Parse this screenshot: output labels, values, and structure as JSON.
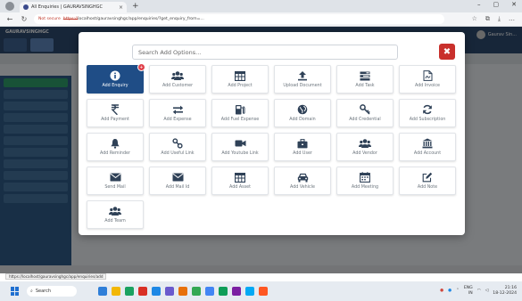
{
  "browser": {
    "tab_title": "All Enquiries | GAURAVSINGHGC",
    "close_tab": "×",
    "new_tab": "+",
    "url_security": "Not secure",
    "url_scheme": "https://",
    "url_rest": "localhost/gauravsinghgc/app/enquiries/?get_enquiry_from=...",
    "window_controls": [
      "–",
      "▢",
      "✕"
    ],
    "toolbar_icons": [
      "☆",
      "⧉",
      "⤓",
      "…"
    ]
  },
  "app": {
    "brand": "GAURAVSINGHGC",
    "user_name": "Gaurav Sin..."
  },
  "modal": {
    "search_placeholder": "Search Add Options...",
    "close_label": "✖",
    "items": [
      {
        "label": "Add Enquiry",
        "icon": "info-icon",
        "active": true,
        "badge": "+"
      },
      {
        "label": "Add Customer",
        "icon": "users-icon"
      },
      {
        "label": "Add Project",
        "icon": "table-icon"
      },
      {
        "label": "Upload Document",
        "icon": "upload-icon"
      },
      {
        "label": "Add Task",
        "icon": "tasks-icon"
      },
      {
        "label": "Add Invoice",
        "icon": "invoice-icon"
      },
      {
        "label": "Add Payment",
        "icon": "rupee-icon"
      },
      {
        "label": "Add Expense",
        "icon": "exchange-icon"
      },
      {
        "label": "Add Fuel Expense",
        "icon": "fuel-icon"
      },
      {
        "label": "Add Domain",
        "icon": "globe-icon"
      },
      {
        "label": "Add Credential",
        "icon": "key-icon"
      },
      {
        "label": "Add Subscription",
        "icon": "refresh-icon"
      },
      {
        "label": "Add Reminder",
        "icon": "bell-icon"
      },
      {
        "label": "Add Useful Link",
        "icon": "link-icon"
      },
      {
        "label": "Add Youtube Link",
        "icon": "video-icon"
      },
      {
        "label": "Add User",
        "icon": "briefcase-icon"
      },
      {
        "label": "Add Vendor",
        "icon": "users-icon"
      },
      {
        "label": "Add Account",
        "icon": "bank-icon"
      },
      {
        "label": "Send Mail",
        "icon": "mail-icon"
      },
      {
        "label": "Add Mail Id",
        "icon": "mail-icon"
      },
      {
        "label": "Add Asset",
        "icon": "table-icon"
      },
      {
        "label": "Add Vehicle",
        "icon": "car-icon"
      },
      {
        "label": "Add Meeting",
        "icon": "calendar-icon"
      },
      {
        "label": "Add Note",
        "icon": "edit-icon"
      },
      {
        "label": "Add Team",
        "icon": "users-icon"
      }
    ]
  },
  "status_url": "https://localhost/gauravsinghgc/app/enquiries/add",
  "taskbar": {
    "search_label": "Search",
    "lang_top": "ENG",
    "lang_bottom": "IN",
    "time": "21:16",
    "date": "18-12-2024"
  },
  "colors": {
    "accent": "#1f4d86",
    "close": "#c9302c",
    "app_header": "#2d4a6e"
  }
}
